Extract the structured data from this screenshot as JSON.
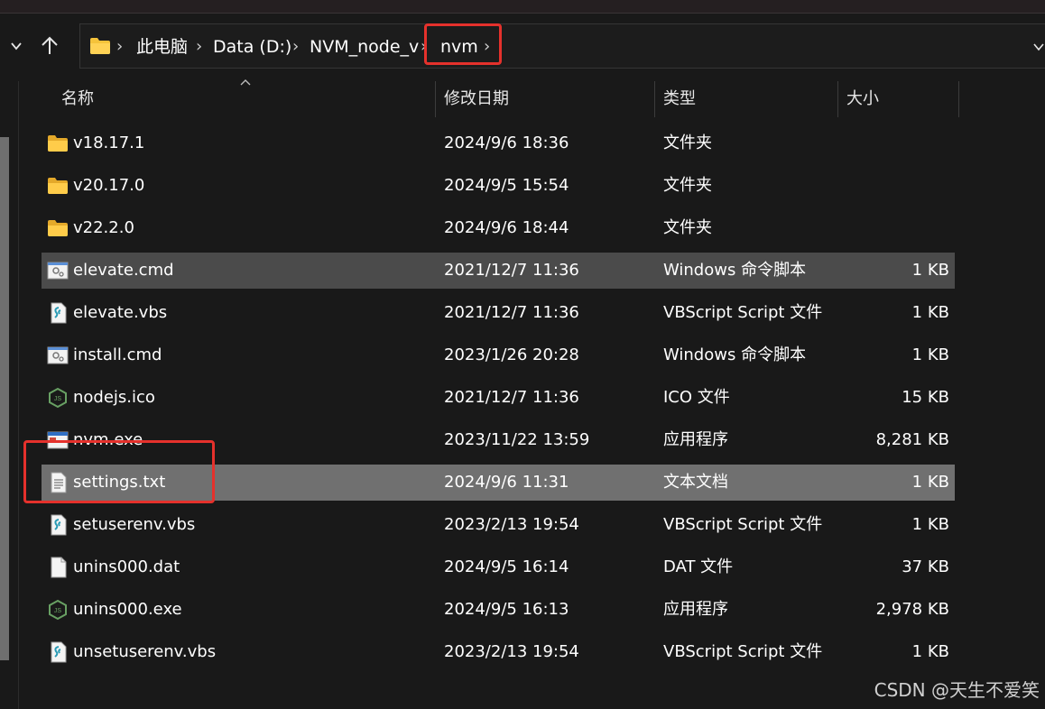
{
  "address": {
    "crumbs": [
      "此电脑",
      "Data (D:)",
      "NVM_node_v",
      "nvm"
    ],
    "sep": "›"
  },
  "columns": {
    "name": "名称",
    "date": "修改日期",
    "type": "类型",
    "size": "大小"
  },
  "files": [
    {
      "name": "v18.17.1",
      "date": "2024/9/6 18:36",
      "type": "文件夹",
      "size": "",
      "icon": "folder-icon"
    },
    {
      "name": "v20.17.0",
      "date": "2024/9/5 15:54",
      "type": "文件夹",
      "size": "",
      "icon": "folder-icon"
    },
    {
      "name": "v22.2.0",
      "date": "2024/9/6 18:44",
      "type": "文件夹",
      "size": "",
      "icon": "folder-icon"
    },
    {
      "name": "elevate.cmd",
      "date": "2021/12/7 11:36",
      "type": "Windows 命令脚本",
      "size": "1 KB",
      "icon": "cmd-script-icon"
    },
    {
      "name": "elevate.vbs",
      "date": "2021/12/7 11:36",
      "type": "VBScript Script 文件",
      "size": "1 KB",
      "icon": "vbs-script-icon"
    },
    {
      "name": "install.cmd",
      "date": "2023/1/26 20:28",
      "type": "Windows 命令脚本",
      "size": "1 KB",
      "icon": "cmd-script-icon"
    },
    {
      "name": "nodejs.ico",
      "date": "2021/12/7 11:36",
      "type": "ICO 文件",
      "size": "15 KB",
      "icon": "nodejs-icon"
    },
    {
      "name": "nvm.exe",
      "date": "2023/11/22 13:59",
      "type": "应用程序",
      "size": "8,281 KB",
      "icon": "exe-window-icon"
    },
    {
      "name": "settings.txt",
      "date": "2024/9/6 11:31",
      "type": "文本文档",
      "size": "1 KB",
      "icon": "text-document-icon"
    },
    {
      "name": "setuserenv.vbs",
      "date": "2023/2/13 19:54",
      "type": "VBScript Script 文件",
      "size": "1 KB",
      "icon": "vbs-script-icon"
    },
    {
      "name": "unins000.dat",
      "date": "2024/9/5 16:14",
      "type": "DAT 文件",
      "size": "37 KB",
      "icon": "blank-file-icon"
    },
    {
      "name": "unins000.exe",
      "date": "2024/9/5 16:13",
      "type": "应用程序",
      "size": "2,978 KB",
      "icon": "nodejs-icon"
    },
    {
      "name": "unsetuserenv.vbs",
      "date": "2023/2/13 19:54",
      "type": "VBScript Script 文件",
      "size": "1 KB",
      "icon": "vbs-script-icon"
    }
  ],
  "watermark": "CSDN @天生不爱笑",
  "colors": {
    "background": "#191919",
    "selected_row": "#707070",
    "hover_row": "#4b4b4b",
    "folder": "#f5c33b",
    "highlight_box": "#e5312c"
  }
}
